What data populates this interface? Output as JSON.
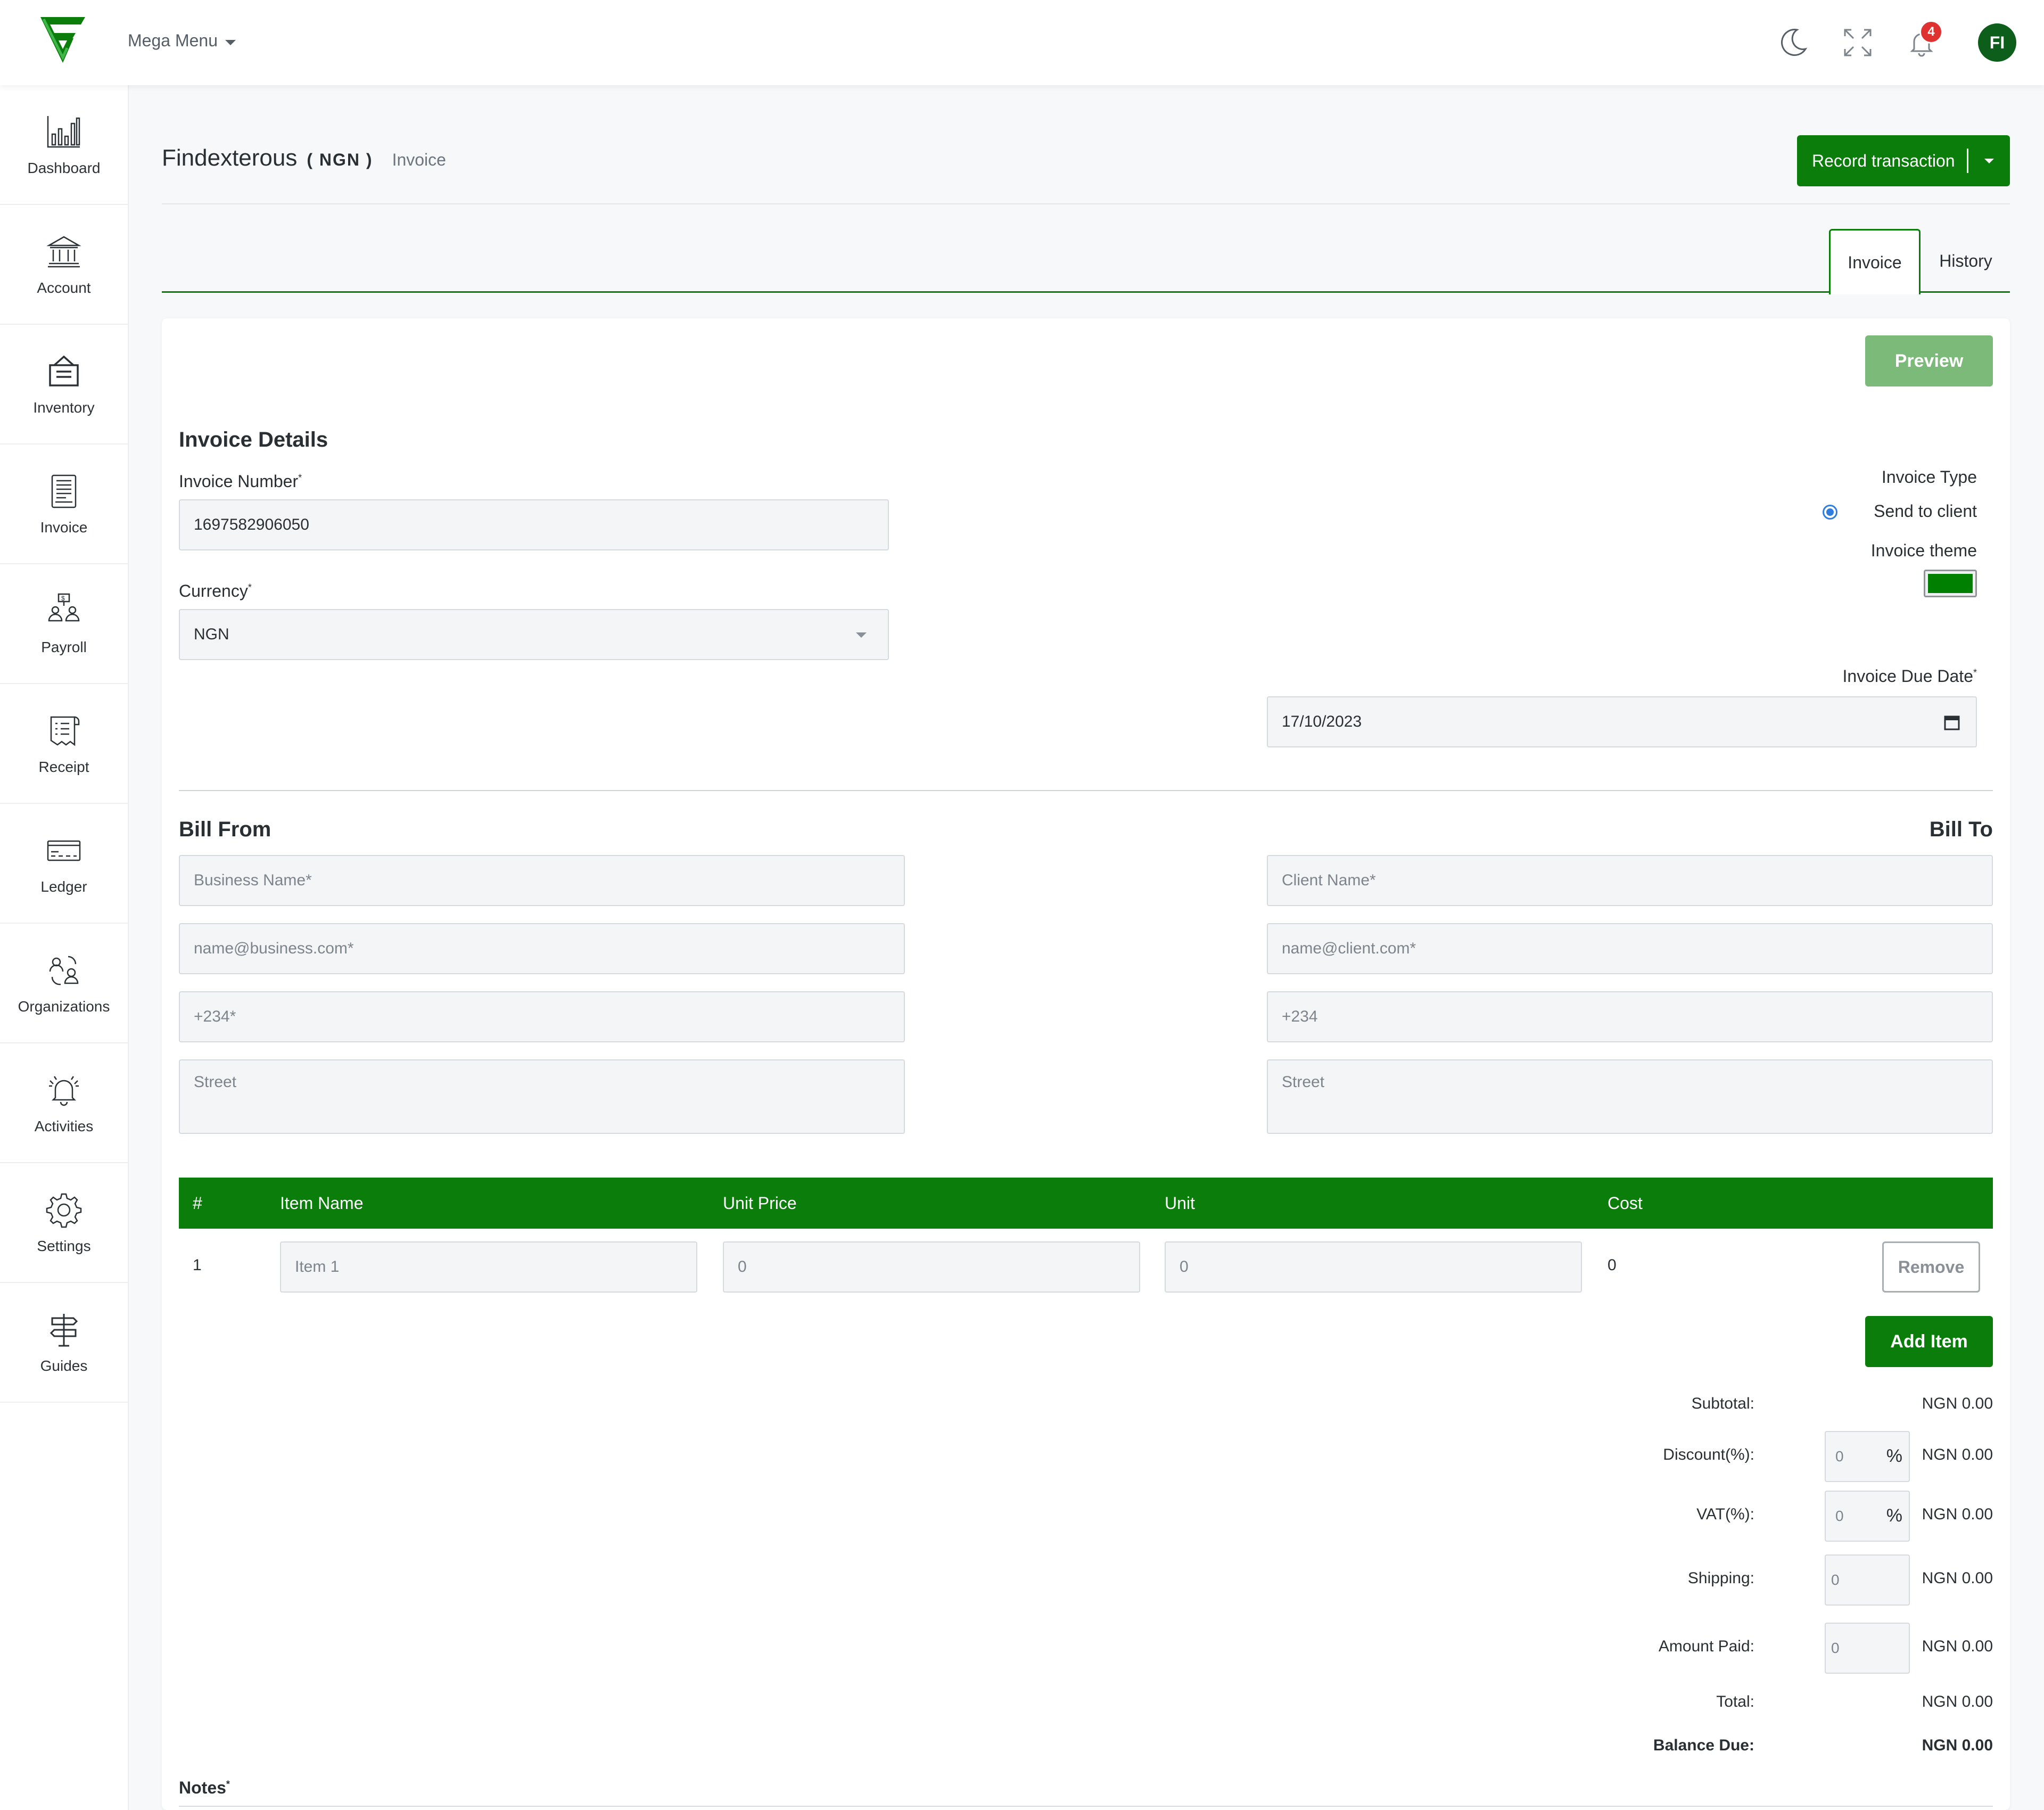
{
  "topbar": {
    "mega_menu": "Mega Menu",
    "notification_count": "4",
    "avatar_initials": "FI"
  },
  "sidebar": {
    "items": [
      {
        "label": "Dashboard",
        "icon": "bar-chart-icon"
      },
      {
        "label": "Account",
        "icon": "bank-icon"
      },
      {
        "label": "Inventory",
        "icon": "inventory-box-icon"
      },
      {
        "label": "Invoice",
        "icon": "invoice-doc-icon"
      },
      {
        "label": "Payroll",
        "icon": "payroll-people-icon"
      },
      {
        "label": "Receipt",
        "icon": "receipt-icon"
      },
      {
        "label": "Ledger",
        "icon": "ledger-card-icon"
      },
      {
        "label": "Organizations",
        "icon": "organizations-icon"
      },
      {
        "label": "Activities",
        "icon": "alarm-bell-icon"
      },
      {
        "label": "Settings",
        "icon": "gear-icon"
      },
      {
        "label": "Guides",
        "icon": "signpost-icon"
      }
    ]
  },
  "header": {
    "org_name": "Findexterous",
    "currency_tag": "( NGN )",
    "breadcrumb": "Invoice",
    "record_button": "Record transaction"
  },
  "tabs": [
    {
      "label": "Invoice",
      "active": true
    },
    {
      "label": "History",
      "active": false
    }
  ],
  "form": {
    "preview_button": "Preview",
    "details_heading": "Invoice Details",
    "invoice_number_label": "Invoice Number",
    "invoice_number_value": "1697582906050",
    "currency_label": "Currency",
    "currency_value": "NGN",
    "invoice_type_label": "Invoice Type",
    "invoice_type_option": "Send to client",
    "theme_label": "Invoice theme",
    "theme_color": "#008000",
    "due_date_label": "Invoice Due Date",
    "due_date_value": "17/10/2023",
    "required_mark": "*",
    "bill_from_heading": "Bill From",
    "bill_to_heading": "Bill To",
    "from_business_placeholder": "Business Name*",
    "from_email_placeholder": "name@business.com*",
    "from_phone_placeholder": "+234*",
    "from_street_placeholder": "Street",
    "to_client_placeholder": "Client Name*",
    "to_email_placeholder": "name@client.com*",
    "to_phone_placeholder": "+234",
    "to_street_placeholder": "Street"
  },
  "items_table": {
    "headers": [
      "#",
      "Item Name",
      "Unit Price",
      "Unit",
      "Cost"
    ],
    "rows": [
      {
        "num": "1",
        "name_placeholder": "Item 1",
        "price_placeholder": "0",
        "unit_placeholder": "0",
        "cost": "0",
        "remove_label": "Remove"
      }
    ],
    "add_button": "Add Item"
  },
  "totals": {
    "subtotal_label": "Subtotal:",
    "subtotal_value": "NGN 0.00",
    "discount_label": "Discount(%):",
    "discount_input": "0",
    "discount_value": "NGN 0.00",
    "vat_label": "VAT(%):",
    "vat_input": "0",
    "vat_value": "NGN 0.00",
    "shipping_label": "Shipping:",
    "shipping_input": "0",
    "shipping_value": "NGN 0.00",
    "paid_label": "Amount Paid:",
    "paid_input": "0",
    "paid_value": "NGN 0.00",
    "total_label": "Total:",
    "total_value": "NGN 0.00",
    "balance_label": "Balance Due:",
    "balance_value": "NGN 0.00",
    "percent_sign": "%"
  },
  "notes_label": "Notes",
  "colors": {
    "brand_green": "#0a7d0a",
    "preview_green": "#7cba7a",
    "badge_red": "#e03131",
    "radio_blue": "#2f7de1"
  }
}
